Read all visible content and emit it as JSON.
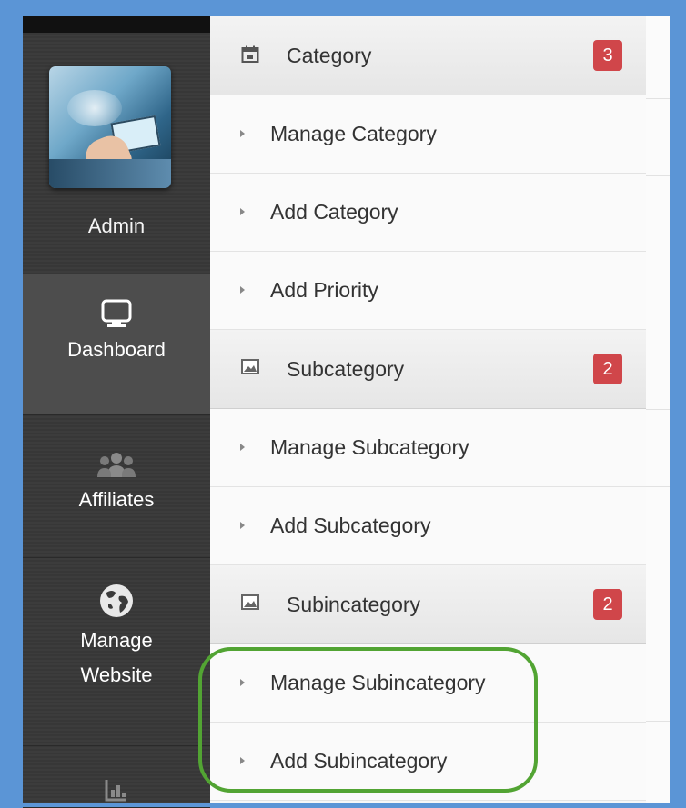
{
  "profile": {
    "name": "Admin"
  },
  "sidebar": {
    "items": [
      {
        "label": "Dashboard",
        "icon": "monitor-icon",
        "active": true
      },
      {
        "label": "Affiliates",
        "icon": "users-group-icon",
        "active": false
      },
      {
        "label_line1": "Manage",
        "label_line2": "Website",
        "icon": "globe-icon",
        "active": false
      },
      {
        "label": "",
        "icon": "bar-chart-icon",
        "active": false
      }
    ]
  },
  "submenu": {
    "sections": [
      {
        "title": "Category",
        "icon": "calendar-icon",
        "badge": "3",
        "items": [
          "Manage Category",
          "Add Category",
          "Add Priority"
        ]
      },
      {
        "title": "Subcategory",
        "icon": "image-icon",
        "badge": "2",
        "items": [
          "Manage Subcategory",
          "Add Subcategory"
        ]
      },
      {
        "title": "Subincategory",
        "icon": "image-icon",
        "badge": "2",
        "items": [
          "Manage Subincategory",
          "Add Subincategory"
        ]
      }
    ]
  },
  "colors": {
    "background": "#5b95d6",
    "sidebar": "#3a3a3a",
    "badge": "#d0464a",
    "highlight": "#52a433"
  }
}
